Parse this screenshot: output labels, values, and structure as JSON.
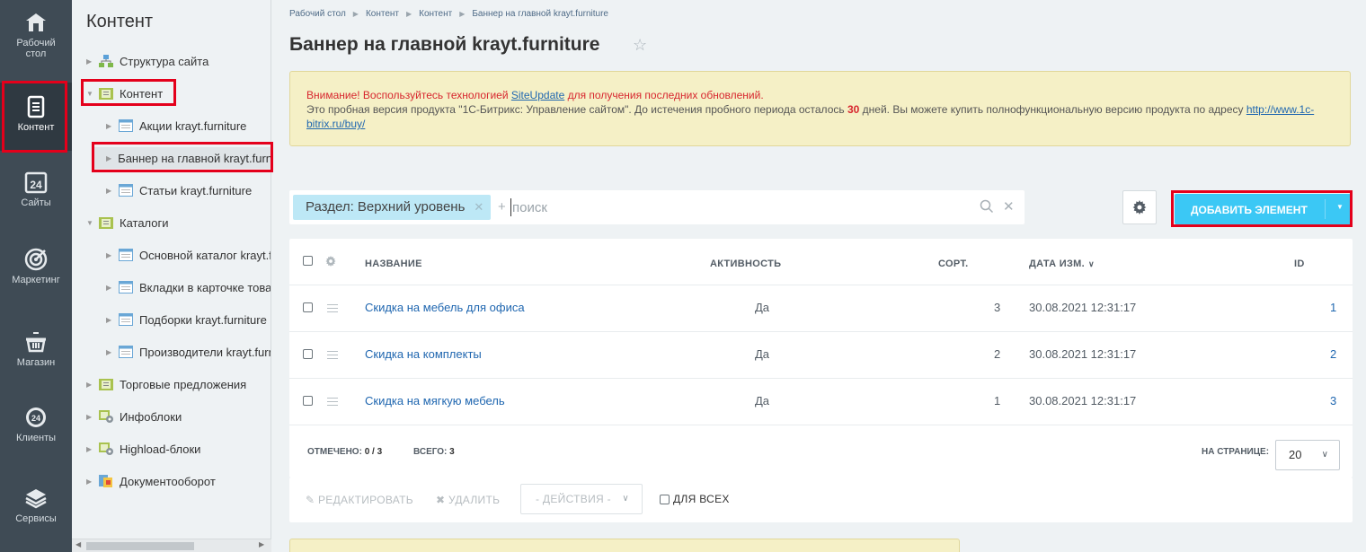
{
  "rail": {
    "items": [
      {
        "label1": "Рабочий",
        "label2": "стол",
        "icon": "home-icon"
      },
      {
        "label1": "Контент",
        "label2": "",
        "icon": "document-icon"
      },
      {
        "label1": "Сайты",
        "label2": "",
        "icon": "calendar-24-icon"
      },
      {
        "label1": "Маркетинг",
        "label2": "",
        "icon": "target-icon"
      },
      {
        "label1": "Магазин",
        "label2": "",
        "icon": "basket-icon"
      },
      {
        "label1": "Клиенты",
        "label2": "",
        "icon": "crm-24-icon"
      },
      {
        "label1": "Сервисы",
        "label2": "",
        "icon": "layers-icon"
      }
    ]
  },
  "tree": {
    "title": "Контент",
    "items": [
      {
        "label": "Структура сайта",
        "icon": "sitemap-icon"
      },
      {
        "label": "Контент",
        "icon": "folder-icon"
      },
      {
        "label": "Акции krayt.furniture",
        "icon": "iblock-icon"
      },
      {
        "label": "Баннер на главной krayt.furniture",
        "icon": "iblock-icon"
      },
      {
        "label": "Статьи krayt.furniture",
        "icon": "iblock-icon"
      },
      {
        "label": "Каталоги",
        "icon": "folder-icon"
      },
      {
        "label": "Основной каталог krayt.furniture",
        "icon": "iblock-icon"
      },
      {
        "label": "Вкладки в карточке товара",
        "icon": "iblock-icon"
      },
      {
        "label": "Подборки krayt.furniture",
        "icon": "iblock-icon"
      },
      {
        "label": "Производители krayt.furniture",
        "icon": "iblock-icon"
      },
      {
        "label": "Торговые предложения",
        "icon": "folder-icon"
      },
      {
        "label": "Инфоблоки",
        "icon": "infoblocks-icon"
      },
      {
        "label": "Highload-блоки",
        "icon": "infoblocks-icon"
      },
      {
        "label": "Документооборот",
        "icon": "workflow-icon"
      }
    ]
  },
  "breadcrumbs": [
    "Рабочий стол",
    "Контент",
    "Контент",
    "Баннер на главной krayt.furniture"
  ],
  "page_title": "Баннер на главной krayt.furniture",
  "notice": {
    "warn_prefix": "Внимание! Воспользуйтесь технологией ",
    "warn_link": "SiteUpdate",
    "warn_suffix": " для получения последних обновлений.",
    "trial_prefix": "Это пробная версия продукта \"1С-Битрикс: Управление сайтом\". До истечения пробного периода осталось ",
    "trial_days": "30",
    "trial_suffix": " дней. Вы можете купить полнофункциональную версию продукта по адресу ",
    "buy_link": "http://www.1c-bitrix.ru/buy/"
  },
  "filter": {
    "chip": "Раздел: Верхний уровень",
    "placeholder": "поиск",
    "plus": "+"
  },
  "add_button": "ДОБАВИТЬ ЭЛЕМЕНТ",
  "table": {
    "headers": {
      "name": "НАЗВАНИЕ",
      "active": "АКТИВНОСТЬ",
      "sort": "СОРТ.",
      "date": "ДАТА ИЗМ.",
      "id": "ID"
    },
    "rows": [
      {
        "name": "Скидка на мебель для офиса",
        "active": "Да",
        "sort": "3",
        "date": "30.08.2021 12:31:17",
        "id": "1"
      },
      {
        "name": "Скидка на комплекты",
        "active": "Да",
        "sort": "2",
        "date": "30.08.2021 12:31:17",
        "id": "2"
      },
      {
        "name": "Скидка на мягкую мебель",
        "active": "Да",
        "sort": "1",
        "date": "30.08.2021 12:31:17",
        "id": "3"
      }
    ],
    "footer": {
      "checked_label": "ОТМЕЧЕНО:",
      "checked_value": "0 / 3",
      "total_label": "ВСЕГО:",
      "total_value": "3",
      "per_page_label": "НА СТРАНИЦЕ:",
      "per_page_value": "20"
    }
  },
  "actions": {
    "edit": "РЕДАКТИРОВАТЬ",
    "delete": "УДАЛИТЬ",
    "select": "- ДЕЙСТВИЯ -",
    "for_all": "ДЛЯ ВСЕХ"
  },
  "colors": {
    "rail_bg": "#3f4b55",
    "accent": "#3bc8f5",
    "highlight_box": "#e4001b",
    "link": "#2067b0"
  }
}
